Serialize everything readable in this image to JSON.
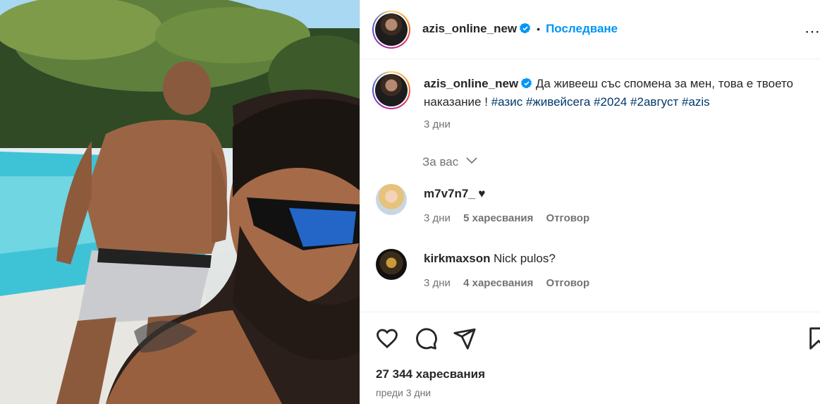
{
  "post": {
    "username": "azis_online_new",
    "follow_label": "Последване",
    "dot": "•",
    "more": "⋯",
    "caption_text": "Да живееш със спомена за мен, това е твоето наказание !",
    "hashtags": [
      "#азис",
      "#живейсега",
      "#2024",
      "#2август",
      "#azis"
    ],
    "caption_time": "3 дни",
    "for_you_label": "За вас",
    "likes_label": "27 344 харесвания",
    "posted_ago": "преди 3 дни"
  },
  "comments": [
    {
      "username": "m7v7n7_",
      "text": "♥",
      "time": "3 дни",
      "likes": "5 харесвания",
      "reply": "Отговор"
    },
    {
      "username": "kirkmaxson",
      "text": "Nick pulos?",
      "time": "3 дни",
      "likes": "4 харесвания",
      "reply": "Отговор"
    }
  ],
  "icons": {
    "like": "heart-icon",
    "comment": "comment-icon",
    "share": "share-icon",
    "save": "bookmark-icon",
    "verified": "verified-badge-icon",
    "chevron": "chevron-down-icon"
  },
  "colors": {
    "accent": "#0095f6",
    "hashtag": "#00376b",
    "muted": "#737373",
    "text": "#262626"
  }
}
